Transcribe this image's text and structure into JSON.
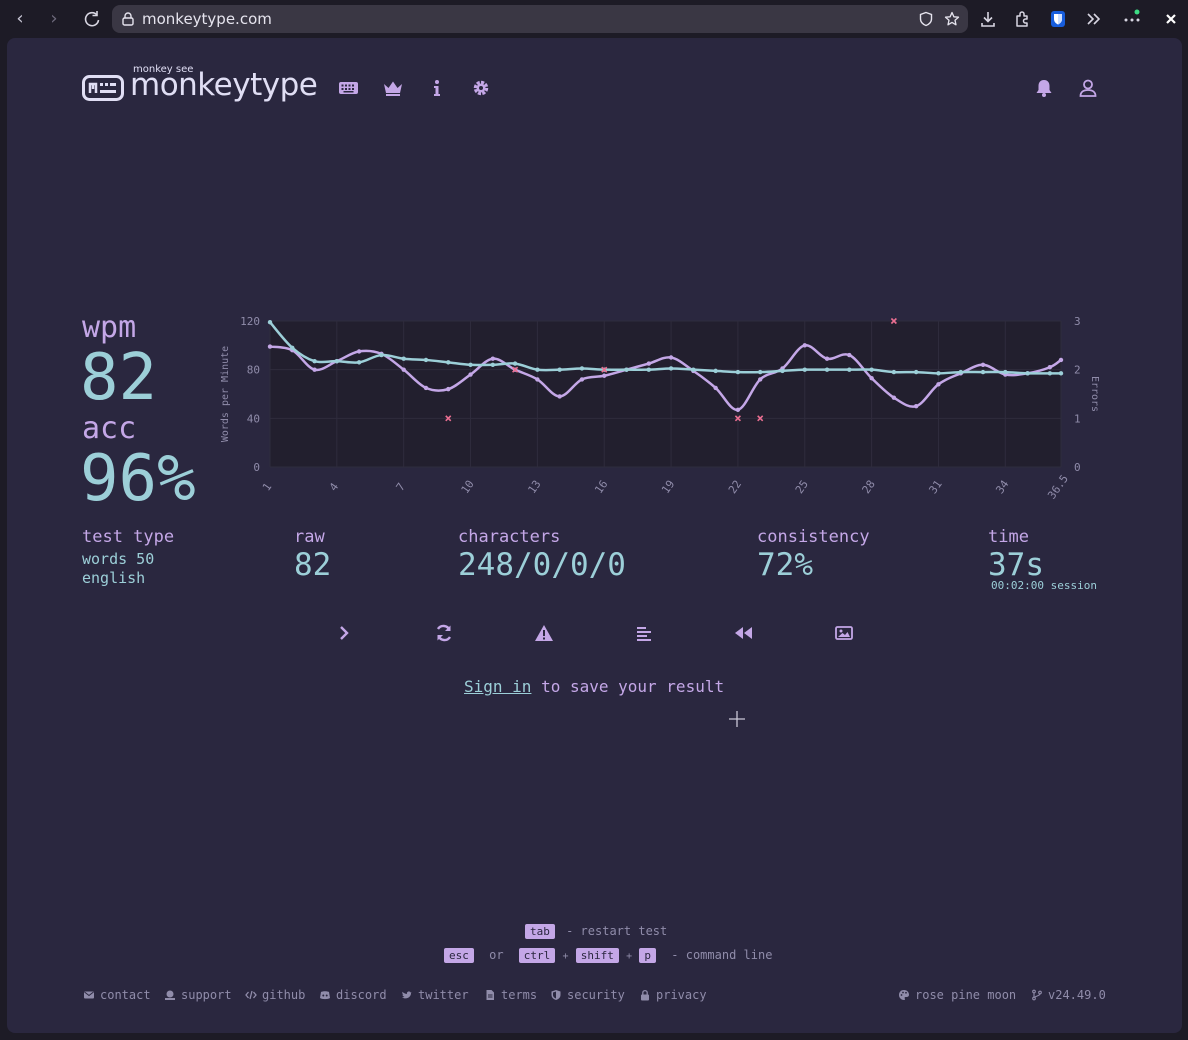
{
  "browser": {
    "url": "monkeytype.com"
  },
  "header": {
    "logo_small": "monkey see",
    "logo_text": "monkeytype"
  },
  "result": {
    "wpm_label": "wpm",
    "wpm_value": "82",
    "acc_label": "acc",
    "acc_value": "96%",
    "test_type_label": "test type",
    "test_type_mode": "words 50",
    "test_type_lang": "english",
    "raw_label": "raw",
    "raw_value": "82",
    "characters_label": "characters",
    "characters_value": "248/0/0/0",
    "consistency_label": "consistency",
    "consistency_value": "72%",
    "time_label": "time",
    "time_value": "37s",
    "session_text": "00:02:00 session"
  },
  "sign_in": {
    "link": "Sign in",
    "rest": " to save your result"
  },
  "hints": {
    "tab_key": "tab",
    "tab_text": "- restart test",
    "esc_key": "esc",
    "or_text": "or",
    "ctrl_key": "ctrl",
    "shift_key": "shift",
    "p_key": "p",
    "plus": "+",
    "cmd_text": "- command line"
  },
  "footer": {
    "contact": "contact",
    "support": "support",
    "github": "github",
    "discord": "discord",
    "twitter": "twitter",
    "terms": "terms",
    "security": "security",
    "privacy": "privacy",
    "theme": "rose pine moon",
    "version": "v24.49.0"
  },
  "colors": {
    "background": "#2a273f",
    "main": "#9ccfd8",
    "sub": "#c4a7e7",
    "text": "#e0def4",
    "error": "#eb6f92"
  },
  "chart_data": {
    "type": "line",
    "ylabel": "Words per Minute",
    "y2label": "Errors",
    "ylim": [
      0,
      120
    ],
    "y2lim": [
      0,
      3
    ],
    "yticks": [
      "0",
      "40",
      "80",
      "120"
    ],
    "y2ticks": [
      "0",
      "1",
      "2",
      "3"
    ],
    "xticks": [
      "1",
      "4",
      "7",
      "10",
      "13",
      "16",
      "19",
      "22",
      "25",
      "28",
      "31",
      "34",
      "36.5"
    ],
    "xtick_values": [
      1,
      4,
      7,
      10,
      13,
      16,
      19,
      22,
      25,
      28,
      31,
      34,
      36.5
    ],
    "x": [
      1,
      2,
      3,
      4,
      5,
      6,
      7,
      8,
      9,
      10,
      11,
      12,
      13,
      14,
      15,
      16,
      17,
      18,
      19,
      20,
      21,
      22,
      23,
      24,
      25,
      26,
      27,
      28,
      29,
      30,
      31,
      32,
      33,
      34,
      35,
      36,
      36.5
    ],
    "series": [
      {
        "color": "#9ccfd8",
        "values": [
          119,
          98,
          87,
          87,
          86,
          92,
          89,
          88,
          86,
          84,
          84,
          85,
          80,
          80,
          81,
          80,
          80,
          80,
          81,
          80,
          79,
          78,
          78,
          79,
          80,
          80,
          80,
          80,
          78,
          78,
          77,
          78,
          78,
          78,
          77,
          77,
          77
        ]
      },
      {
        "color": "#c4a7e7",
        "values": [
          99,
          96,
          80,
          87,
          95,
          93,
          80,
          65,
          64,
          76,
          89,
          80,
          72,
          58,
          72,
          75,
          80,
          85,
          90,
          79,
          65,
          47,
          72,
          81,
          100,
          89,
          92,
          73,
          57,
          50,
          68,
          77,
          84,
          76,
          77,
          82,
          88
        ]
      }
    ],
    "errors": [
      {
        "x": 9,
        "y": 1
      },
      {
        "x": 12,
        "y": 2
      },
      {
        "x": 16,
        "y": 2
      },
      {
        "x": 22,
        "y": 1
      },
      {
        "x": 23,
        "y": 1
      },
      {
        "x": 29,
        "y": 3
      }
    ]
  }
}
